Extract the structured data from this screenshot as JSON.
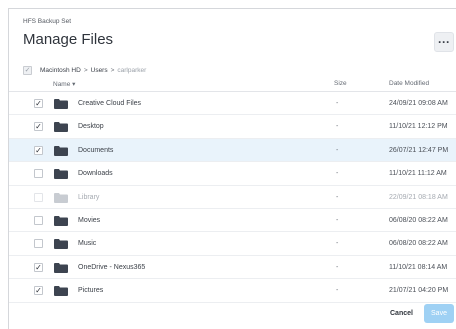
{
  "dialog": {
    "subtitle": "HFS Backup Set",
    "title": "Manage Files",
    "more_label": "···"
  },
  "path": {
    "root_check": "✓",
    "crumbs": [
      "Macintosh HD",
      "Users",
      "carlparker"
    ],
    "separator": ">"
  },
  "columns": {
    "name": "Name ▾",
    "size": "Size",
    "date": "Date Modified"
  },
  "rows": [
    {
      "name": "Creative Cloud Files",
      "size": "-",
      "date": "24/09/21 09:08 AM",
      "check": "✓"
    },
    {
      "name": "Desktop",
      "size": "-",
      "date": "11/10/21 12:12 PM",
      "check": "✓"
    },
    {
      "name": "Documents",
      "size": "-",
      "date": "26/07/21 12:47 PM",
      "check": "✓"
    },
    {
      "name": "Downloads",
      "size": "-",
      "date": "11/10/21 11:12 AM",
      "check": ""
    },
    {
      "name": "Library",
      "size": "-",
      "date": "22/09/21 08:18 AM",
      "check": ""
    },
    {
      "name": "Movies",
      "size": "-",
      "date": "06/08/20 08:22 AM",
      "check": ""
    },
    {
      "name": "Music",
      "size": "-",
      "date": "06/08/20 08:22 AM",
      "check": ""
    },
    {
      "name": "OneDrive - Nexus365",
      "size": "-",
      "date": "11/10/21 08:14 AM",
      "check": "✓"
    },
    {
      "name": "Pictures",
      "size": "-",
      "date": "21/07/21 04:20 PM",
      "check": "✓"
    }
  ],
  "buttons": {
    "cancel": "Cancel",
    "save": "Save"
  },
  "colors": {
    "selected_row": "#e9f3fb",
    "save_button": "#9fd1f4",
    "folder": "#3d4450"
  },
  "icons": {
    "folder": "folder-icon",
    "more": "more-icon",
    "checkbox": "checkbox-icon"
  }
}
